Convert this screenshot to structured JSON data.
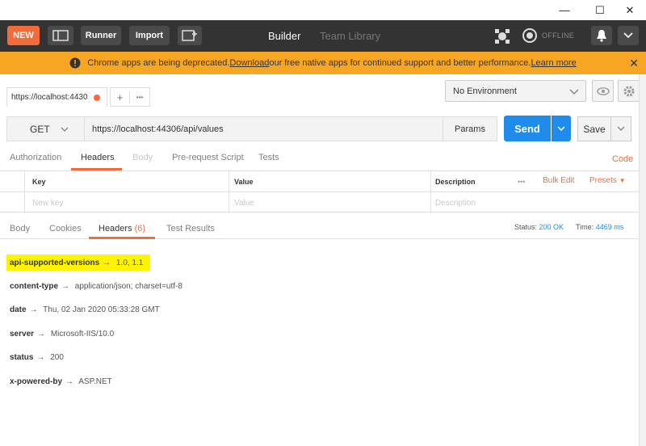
{
  "window": {
    "minimize_glyph": "—",
    "maximize_glyph": "☐",
    "close_glyph": "✕"
  },
  "appbar": {
    "new_label": "NEW",
    "runner_label": "Runner",
    "import_label": "Import",
    "tabs": [
      {
        "label": "Builder",
        "active": true
      },
      {
        "label": "Team Library",
        "active": false
      }
    ],
    "offline_label": "OFFLINE"
  },
  "banner": {
    "text_before": "Chrome apps are being deprecated. ",
    "download_link": "Download",
    "text_middle": " our free native apps for continued support and better performance. ",
    "learn_more_link": "Learn more",
    "accent_color": "#f6a623"
  },
  "request_tab": {
    "label": "https://localhost:4430",
    "plus": "+",
    "more": "•••"
  },
  "environment": {
    "selected": "No Environment"
  },
  "request": {
    "method": "GET",
    "url": "https://localhost:44306/api/values",
    "params_label": "Params",
    "send_label": "Send",
    "save_label": "Save"
  },
  "request_tabs": [
    {
      "label": "Authorization",
      "state": "normal"
    },
    {
      "label": "Headers",
      "state": "active"
    },
    {
      "label": "Body",
      "state": "disabled"
    },
    {
      "label": "Pre-request Script",
      "state": "normal"
    },
    {
      "label": "Tests",
      "state": "normal"
    }
  ],
  "code_link": "Code",
  "headers_table": {
    "col_key": "Key",
    "col_value": "Value",
    "col_description": "Description",
    "more": "•••",
    "bulk_edit": "Bulk Edit",
    "presets": "Presets",
    "placeholder_key": "New key",
    "placeholder_value": "Value",
    "placeholder_description": "Description"
  },
  "response_tabs": [
    {
      "label": "Body",
      "count": ""
    },
    {
      "label": "Cookies",
      "count": ""
    },
    {
      "label": "Headers",
      "count": "(6)"
    },
    {
      "label": "Test Results",
      "count": ""
    }
  ],
  "status": {
    "status_label": "Status:",
    "status_value": "200 OK",
    "time_label": "Time:",
    "time_value": "4469 ms"
  },
  "response_headers": [
    {
      "key": "api-supported-versions",
      "value": "1.0, 1.1",
      "highlighted": true
    },
    {
      "key": "content-type",
      "value": "application/json; charset=utf-8",
      "highlighted": false
    },
    {
      "key": "date",
      "value": "Thu, 02 Jan 2020 05:33:28 GMT",
      "highlighted": false
    },
    {
      "key": "server",
      "value": "Microsoft-IIS/10.0",
      "highlighted": false
    },
    {
      "key": "status",
      "value": "200",
      "highlighted": false
    },
    {
      "key": "x-powered-by",
      "value": "ASP.NET",
      "highlighted": false
    }
  ],
  "arrow_glyph": "→",
  "colors": {
    "brand_orange": "#f26b3a",
    "send_blue": "#1f8ceb",
    "appbar_dark": "#333333",
    "highlight_yellow": "#fff400"
  }
}
